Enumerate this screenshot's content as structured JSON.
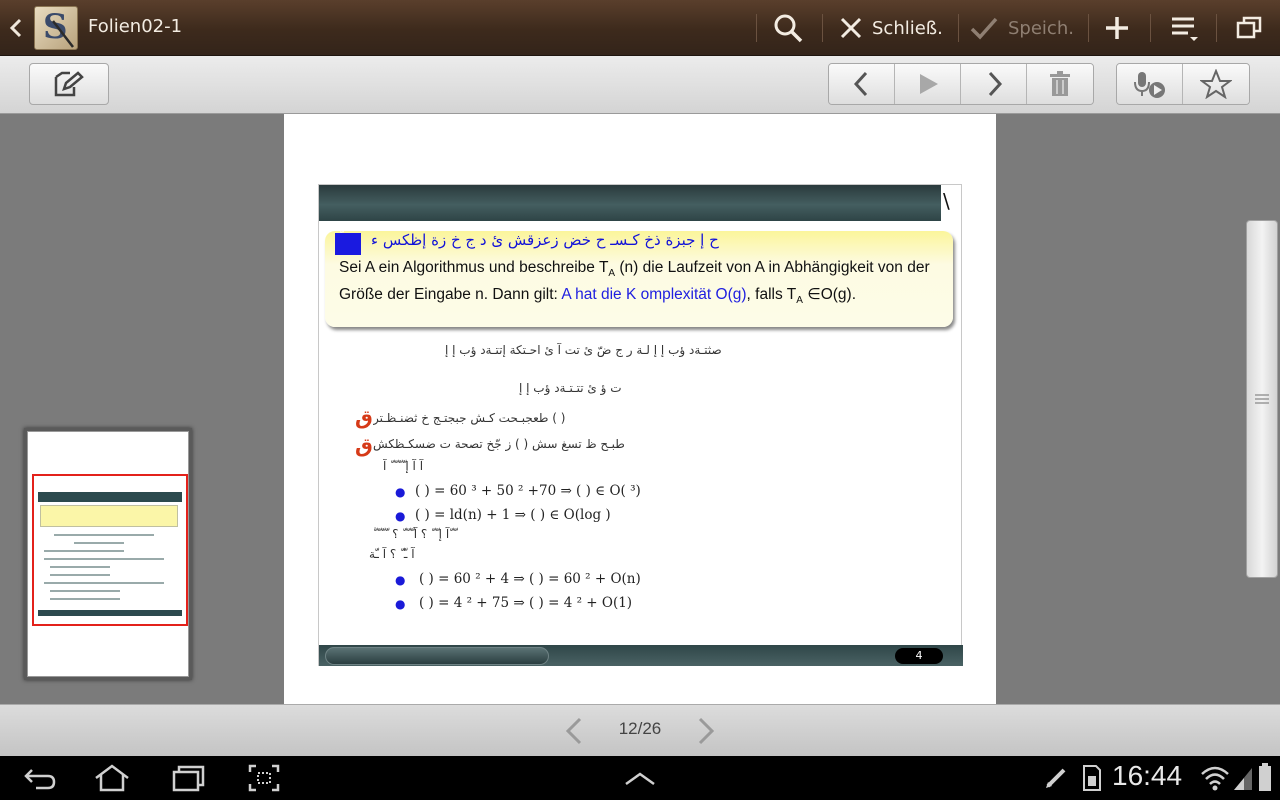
{
  "app": {
    "title": "Folien02-1",
    "icon_letter": "S"
  },
  "actionbar": {
    "close_label": "Schließ.",
    "save_label": "Speich."
  },
  "slide": {
    "definition_garbled": "ح إ جبزة ذخ كـسـ ح خض زعزقش ئ د ج خ   زة إظكس ء",
    "definition_text_1": "Sei A  ein Algorithmus und beschreibe T",
    "definition_sub_a": "A",
    "definition_text_2": " (n)  die Laufzeit von A  in Abhängigkeit von der Größe der Eingabe n.  Dann gilt: ",
    "definition_blue": "A hat die K omplexität  O(g)",
    "definition_text_3": ",  falls T",
    "definition_text_4": "  ∈O(g).",
    "line_garbled_1": "صثتـةد ؤب إ إ لـة ر ج ضّ ئ تت آ ئ احـتكة   إتتـةد ؤب إ إ",
    "line_garbled_2": "ت ؤ ئ تتـتـةد ؤب إ إ",
    "q1_text": "طعجبـحت كـش جبجتـج خ ثضنـظـتر     (  )",
    "q2_text": "طبـح ظ تسغ سش   (  )  ز جّخ تصحة ت ضسكـظكش",
    "q2_sub": "آ   آ إ   ّ  ّ  ّ  ّ  آ",
    "b1": "(  ) = 60   ³ + 50   ² +70   ⇒    (  ) ∈ O(   ³)",
    "b2": "(  ) = ld(n) + 1 ⇒    (  ) ∈ O(log    )",
    "para_garbled_1": "ّ  ّ  ّ  ّ  ّ  آ إ  ّ  ّ  ؟ آ  ّ  ّ  ّ  ؟ ّ  ّ",
    "para_garbled_2": "آ ـّ  ّ ؟ آ ـّة",
    "b3": "(  ) = 60   ² + 4      ⇒     (  ) = 60   ² + O(n)",
    "b4": "(  ) =    4   ² + 75    ⇒     (  ) =    4   ² + O(1)",
    "slide_number": "4"
  },
  "pagebar": {
    "page_indicator": "12/26"
  },
  "status": {
    "clock": "16:44"
  }
}
